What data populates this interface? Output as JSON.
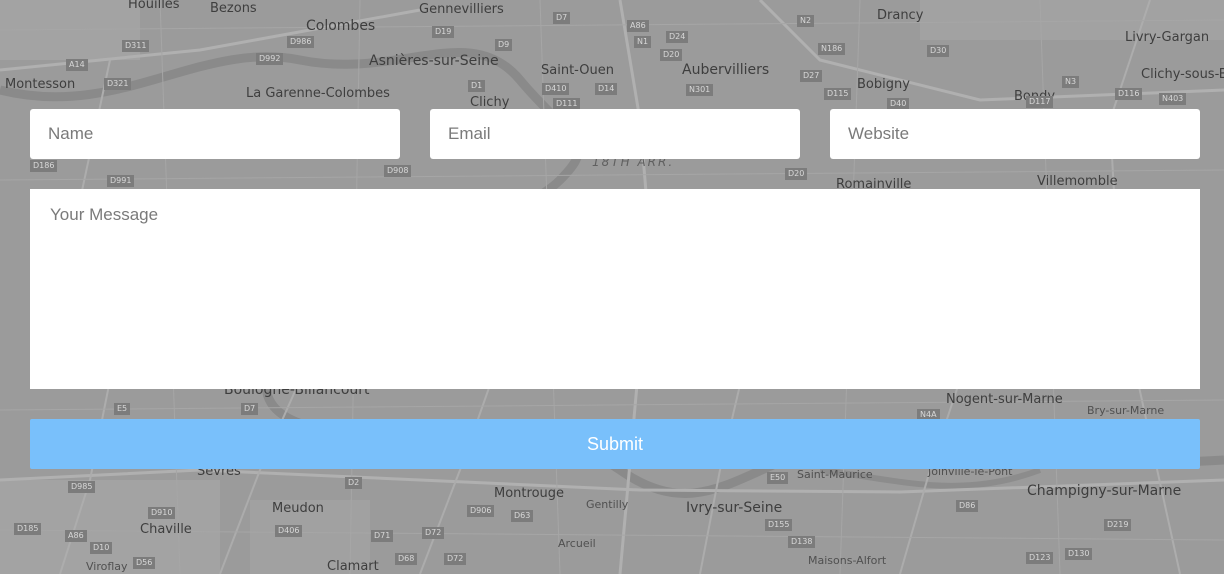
{
  "map": {
    "places": [
      "Houilles",
      "Bezons",
      "Colombes",
      "Gennevilliers",
      "Drancy",
      "Livry-Gargan",
      "Montesson",
      "Asnières-sur-Seine",
      "Saint-Ouen",
      "Aubervilliers",
      "Bobigny",
      "Clichy-sous-Bois",
      "La Garenne-Colombes",
      "Clichy",
      "Bondy",
      "18TH ARR.",
      "Romainville",
      "Villemomble",
      "Boulogne-Billancourt",
      "Nogent-sur-Marne",
      "Bry-sur-Marne",
      "Saint-Maurice",
      "Joinville-le-Pont",
      "Sèvres",
      "Montrouge",
      "Gentilly",
      "Ivry-sur-Seine",
      "Champigny-sur-Marne",
      "Meudon",
      "Chaville",
      "Arcueil",
      "Maisons-Alfort",
      "Clamart",
      "Viroflay"
    ],
    "road_tags": [
      "D311",
      "A14",
      "D321",
      "D986",
      "D992",
      "D19",
      "D9",
      "D7",
      "A86",
      "N1",
      "D20",
      "D24",
      "N2",
      "N186",
      "D30",
      "D27",
      "D115",
      "D40",
      "N3",
      "D116",
      "N403",
      "D117",
      "D1",
      "D410",
      "D14",
      "N301",
      "D111",
      "D186",
      "D991",
      "D908",
      "D20",
      "E5",
      "D7",
      "E50",
      "N4A",
      "D2",
      "D985",
      "D910",
      "A86",
      "D406",
      "D71",
      "D72",
      "D906",
      "D63",
      "D155",
      "D138",
      "D86",
      "D219",
      "D123",
      "D130",
      "D185",
      "D10",
      "D56",
      "D68",
      "D72"
    ]
  },
  "form": {
    "name_placeholder": "Name",
    "email_placeholder": "Email",
    "website_placeholder": "Website",
    "message_placeholder": "Your Message",
    "submit_label": "Submit"
  },
  "colors": {
    "map_background": "#9a9a9a",
    "submit_background": "#79c0fb",
    "field_background": "#ffffff"
  }
}
